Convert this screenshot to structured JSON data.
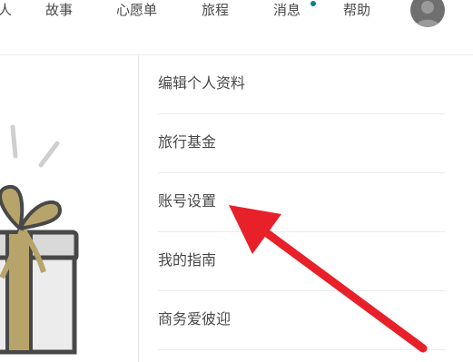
{
  "nav": {
    "partial_item": "人",
    "items": [
      "故事",
      "心愿单",
      "旅程",
      "消息",
      "帮助"
    ],
    "messages_dot_color": "#008489",
    "avatar_icon": "user-avatar"
  },
  "dropdown": {
    "items": [
      "编辑个人资料",
      "旅行基金",
      "账号设置",
      "我的指南",
      "商务爱彼迎"
    ]
  },
  "annotation": {
    "arrow_color": "#e8202a",
    "points_to": "账号设置"
  },
  "illustration": {
    "icon": "gift-box-icon",
    "colors": {
      "outline": "#484848",
      "box": "#d9d9d9",
      "ribbon": "#b7a46a"
    }
  }
}
